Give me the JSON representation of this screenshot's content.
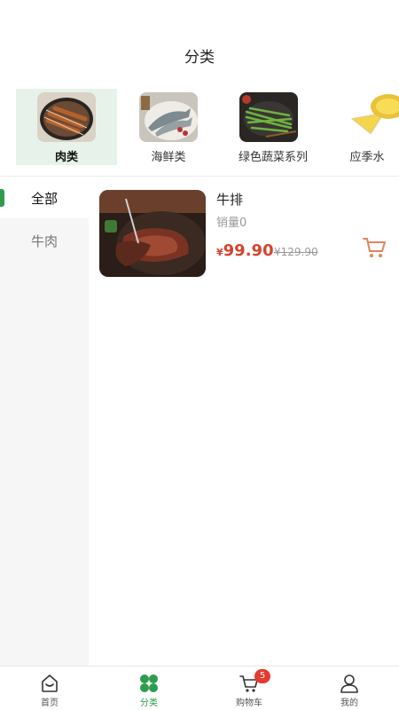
{
  "header": {
    "title": "分类"
  },
  "categories": [
    {
      "label": "肉类",
      "active": true
    },
    {
      "label": "海鲜类",
      "active": false
    },
    {
      "label": "绿色蔬菜系列",
      "active": false
    },
    {
      "label": "应季水",
      "active": false
    }
  ],
  "subnav": [
    {
      "label": "全部",
      "active": true
    },
    {
      "label": "牛肉",
      "active": false
    }
  ],
  "products": [
    {
      "name": "牛排",
      "sales": "销量0",
      "currency": "¥",
      "price": "99.90",
      "original_price": "¥129.90"
    }
  ],
  "tabbar": [
    {
      "label": "首页",
      "icon": "home-icon"
    },
    {
      "label": "分类",
      "icon": "category-icon",
      "active": true
    },
    {
      "label": "购物车",
      "icon": "cart-icon",
      "badge": "5"
    },
    {
      "label": "我的",
      "icon": "user-icon"
    }
  ],
  "colors": {
    "accent": "#2e9c4e",
    "price": "#d4442c",
    "badge": "#e53a2f",
    "cart": "#e0855b"
  }
}
